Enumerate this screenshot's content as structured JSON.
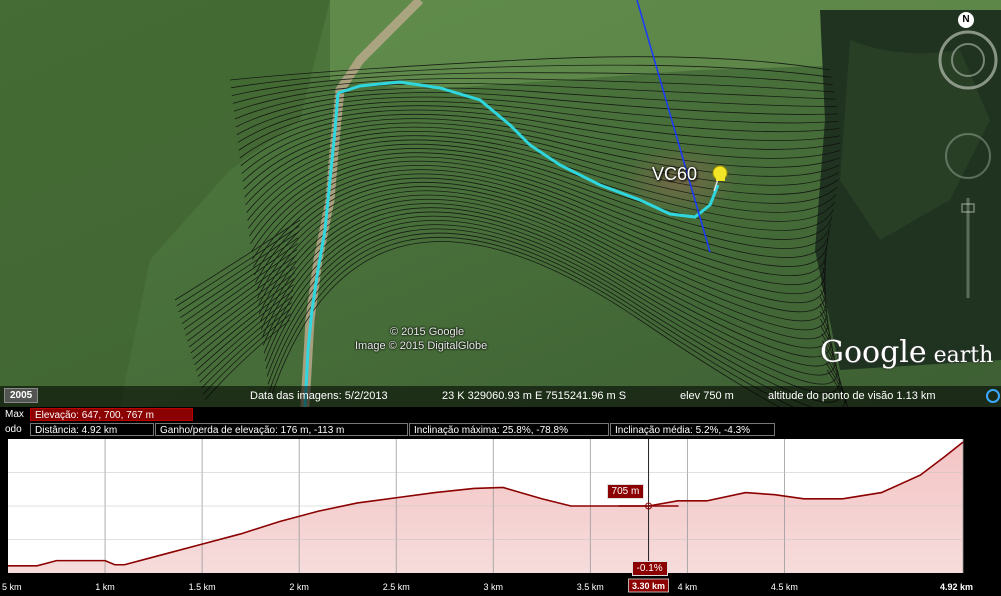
{
  "map": {
    "copyright_google": "© 2015 Google",
    "copyright_image": "Image © 2015 DigitalGlobe",
    "placemark": "VC60",
    "logo_main": "Google",
    "logo_sub": " earth",
    "compass": "N",
    "year": "2005"
  },
  "status": {
    "image_date": "Data das imagens: 5/2/2013",
    "coordinates": "23 K 329060.93 m E 7515241.96 m S",
    "elevation": "elev   750 m",
    "eye_altitude": "altitude do ponto de visão   1.13 km"
  },
  "profile": {
    "max_label": "Max",
    "elevation_box": "Elevação: 647, 700, 767 m",
    "mode_label": "odo",
    "distance": "Distância: 4.92 km",
    "gain_loss": "Ganho/perda de elevação: 176 m, -113 m",
    "max_slope": "Inclinação máxima: 25.8%, -78.8%",
    "avg_slope": "Inclinação média: 5.2%, -4.3%",
    "hover_elevation": "705 m",
    "hover_slope": "-0.1%",
    "hover_distance": "3.30 km"
  },
  "chart_data": {
    "type": "area",
    "xlabel": "",
    "ylabel": "",
    "xlim": [
      0,
      4.92
    ],
    "ylim": [
      640,
      770
    ],
    "x_ticks": [
      "5 km",
      "1 km",
      "1.5 km",
      "2 km",
      "2.5 km",
      "3 km",
      "3.5 km",
      "4 km",
      "4.5 km",
      "4.92 km"
    ],
    "x_tick_values": [
      0.0,
      0.5,
      1.0,
      1.5,
      2.0,
      2.5,
      3.0,
      3.5,
      4.0,
      4.92
    ],
    "x": [
      0,
      0.15,
      0.25,
      0.5,
      0.55,
      0.6,
      0.8,
      1.0,
      1.2,
      1.4,
      1.6,
      1.8,
      2.0,
      2.2,
      2.4,
      2.55,
      2.75,
      2.9,
      3.05,
      3.3,
      3.45,
      3.6,
      3.8,
      3.95,
      4.1,
      4.3,
      4.5,
      4.7,
      4.82,
      4.92
    ],
    "y": [
      647,
      647,
      652,
      652,
      648,
      648,
      658,
      668,
      678,
      690,
      700,
      708,
      713,
      718,
      722,
      723,
      712,
      705,
      705,
      705,
      710,
      710,
      718,
      716,
      712,
      712,
      718,
      735,
      752,
      767
    ],
    "series": [
      {
        "values": [
          647,
          647,
          652,
          652,
          648,
          648,
          658,
          668,
          678,
          690,
          700,
          708,
          713,
          718,
          722,
          723,
          712,
          705,
          705,
          705,
          710,
          710,
          718,
          716,
          712,
          712,
          718,
          735,
          752,
          767
        ]
      }
    ],
    "hover_x": 3.3,
    "hover_y": 705,
    "grid": true,
    "fill_color": "#f4c4c4",
    "line_color": "#8b0000"
  }
}
